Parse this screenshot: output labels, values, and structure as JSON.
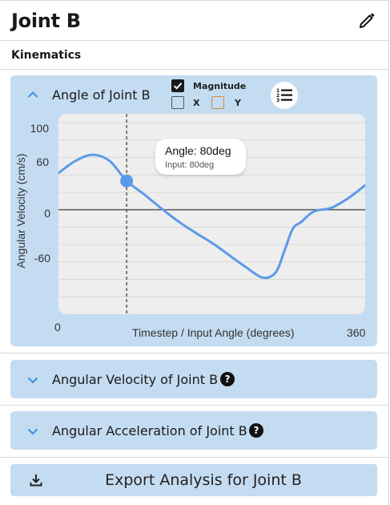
{
  "header": {
    "title": "Joint B",
    "edit_icon": "pencil-icon"
  },
  "section": {
    "label": "Kinematics"
  },
  "main_card": {
    "title": "Angle of Joint B",
    "expanded": true,
    "toggles": {
      "magnitude": {
        "label": "Magnitude",
        "checked": true
      },
      "x": {
        "label": "X",
        "checked": false,
        "color": "#d08c3a"
      },
      "y": {
        "label": "Y",
        "checked": false,
        "color": "#d08c3a"
      }
    },
    "list_icon": "numbered-list-icon",
    "tooltip": {
      "main": "Angle: 80deg",
      "sub": "Input: 80deg"
    }
  },
  "chart_data": {
    "type": "line",
    "ylabel": "Angular Velocity (cm/s)",
    "xlabel": "Timestep / Input Angle (degrees)",
    "y_ticks": [
      "100",
      "60",
      "0",
      "-60"
    ],
    "x_ticks": [
      "0",
      "360"
    ],
    "xlim": [
      0,
      360
    ],
    "ylim": [
      -120,
      110
    ],
    "grid": true,
    "cursor_x": 80,
    "series": [
      {
        "color": "#5b9ae8",
        "x": [
          0,
          20,
          40,
          60,
          80,
          100,
          120,
          140,
          160,
          180,
          200,
          220,
          240,
          255,
          265,
          275,
          285,
          300,
          320,
          340,
          360
        ],
        "y": [
          42,
          56,
          63,
          56,
          33,
          18,
          2,
          -13,
          -26,
          -38,
          -52,
          -66,
          -78,
          -72,
          -48,
          -22,
          -14,
          -2,
          2,
          13,
          28
        ]
      }
    ]
  },
  "collapsed_cards": [
    {
      "title": "Angular Velocity of Joint B"
    },
    {
      "title": "Angular Acceleration of Joint B"
    }
  ],
  "colors": {
    "card_bg": "#c4dcf1",
    "line": "#5b9ae8",
    "plot_bg": "#eeeeee"
  },
  "export": {
    "label": "Export Analysis for Joint B",
    "icon": "download-icon"
  }
}
